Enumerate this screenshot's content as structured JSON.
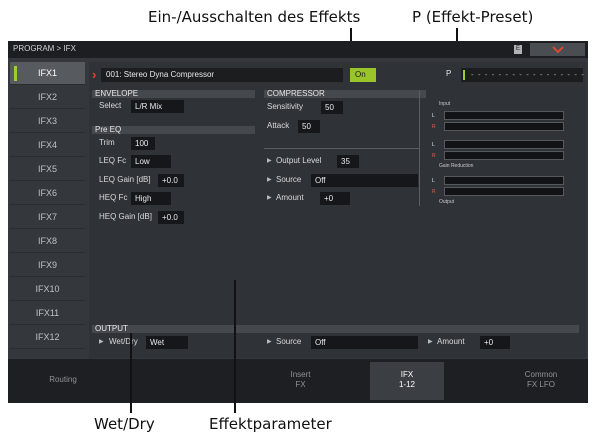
{
  "callouts": {
    "effect_toggle": "Ein-/Ausschalten des Effekts",
    "preset": "P (Effekt-Preset)",
    "wet_dry": "Wet/Dry",
    "parameters": "Effektparameter"
  },
  "topbar": {
    "breadcrumb": "PROGRAM > IFX",
    "sys_icon": "E"
  },
  "sidebar": {
    "items": [
      {
        "label": "IFX1"
      },
      {
        "label": "IFX2"
      },
      {
        "label": "IFX3"
      },
      {
        "label": "IFX4"
      },
      {
        "label": "IFX5"
      },
      {
        "label": "IFX6"
      },
      {
        "label": "IFX7"
      },
      {
        "label": "IFX8"
      },
      {
        "label": "IFX9"
      },
      {
        "label": "IFX10"
      },
      {
        "label": "IFX11"
      },
      {
        "label": "IFX12"
      }
    ]
  },
  "header": {
    "program_name": "001: Stereo Dyna Compressor",
    "on_label": "On",
    "preset_label": "P",
    "preset_value": "- - - - - - - - - - - - - - - - - - - - -"
  },
  "envelope": {
    "title": "ENVELOPE",
    "select_label": "Select",
    "select_value": "L/R Mix"
  },
  "pre_eq": {
    "title": "Pre EQ",
    "trim_label": "Trim",
    "trim_value": "100",
    "leq_fc_label": "LEQ Fc",
    "leq_fc_value": "Low",
    "leq_gain_label": "LEQ Gain [dB]",
    "leq_gain_value": "+0.0",
    "heq_fc_label": "HEQ Fc",
    "heq_fc_value": "High",
    "heq_gain_label": "HEQ Gain [dB]",
    "heq_gain_value": "+0.0"
  },
  "compressor": {
    "title": "COMPRESSOR",
    "sensitivity_label": "Sensitivity",
    "sensitivity_value": "50",
    "attack_label": "Attack",
    "attack_value": "50",
    "output_level_label": "Output Level",
    "output_level_value": "35",
    "source_label": "Source",
    "source_value": "Off",
    "amount_label": "Amount",
    "amount_value": "+0"
  },
  "meters": {
    "input_label": "Input",
    "gain_reduction_label": "Gain Reduction",
    "output_label": "Output",
    "left": "L",
    "right": "R"
  },
  "output": {
    "title": "OUTPUT",
    "wet_dry_label": "Wet/Dry",
    "wet_dry_value": "Wet",
    "source_label": "Source",
    "source_value": "Off",
    "amount_label": "Amount",
    "amount_value": "+0"
  },
  "tabs": {
    "routing": "Routing",
    "insert_1": "Insert",
    "insert_2": "FX",
    "ifx_1": "IFX",
    "ifx_2": "1-12",
    "common_1": "Common",
    "common_2": "FX LFO"
  },
  "colors": {
    "accent_green": "#9ac52a",
    "chevron_red": "#e8472b",
    "screen_bg": "#34383c"
  }
}
